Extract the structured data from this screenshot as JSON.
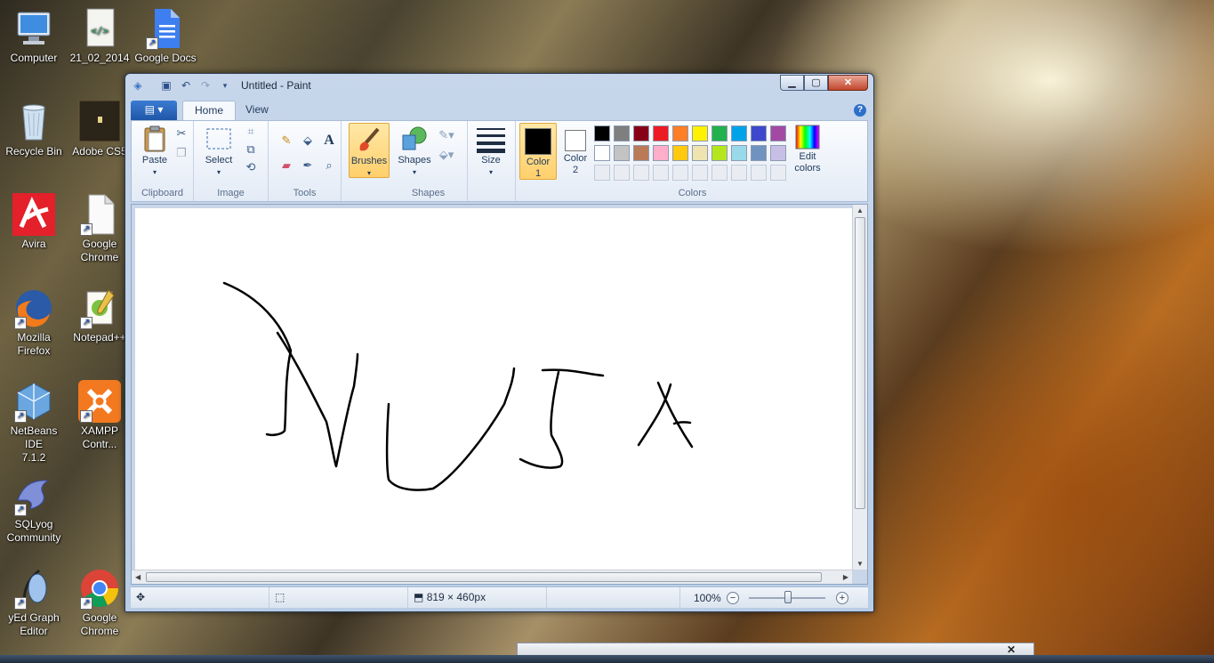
{
  "desktop": {
    "icons": [
      {
        "label": "Computer",
        "icon": "computer-icon"
      },
      {
        "label": "21_02_2014",
        "icon": "html-file-icon"
      },
      {
        "label": "Google Docs",
        "icon": "google-docs-icon"
      },
      {
        "label": "Recycle Bin",
        "icon": "recycle-bin-icon"
      },
      {
        "label": "Adobe CS5",
        "icon": "folder-icon"
      },
      {
        "label": "Avira",
        "icon": "avira-icon"
      },
      {
        "label": "Google\nChrome",
        "icon": "blank-file-icon"
      },
      {
        "label": "Mozilla\nFirefox",
        "icon": "firefox-icon"
      },
      {
        "label": "Notepad++",
        "icon": "notepad-plus-plus-icon"
      },
      {
        "label": "NetBeans IDE\n7.1.2",
        "icon": "netbeans-icon"
      },
      {
        "label": "XAMPP\nContr...",
        "icon": "xampp-icon"
      },
      {
        "label": "SQLyog\nCommunity",
        "icon": "sqlyog-icon"
      },
      {
        "label": "yEd Graph\nEditor",
        "icon": "yed-icon"
      },
      {
        "label": "Google\nChrome",
        "icon": "chrome-icon"
      }
    ]
  },
  "window": {
    "title": "Untitled - Paint",
    "caption": {
      "minimize": "▁",
      "maximize": "▢",
      "close": "✕"
    }
  },
  "ribbon": {
    "app_menu": "▤ ▾",
    "tabs": [
      {
        "label": "Home",
        "active": true
      },
      {
        "label": "View",
        "active": false
      }
    ],
    "groups": {
      "clipboard": {
        "label": "Clipboard",
        "paste": "Paste"
      },
      "image": {
        "label": "Image",
        "select": "Select"
      },
      "tools": {
        "label": "Tools"
      },
      "brushes": {
        "label": "Brushes"
      },
      "shapes": {
        "label": "Shapes",
        "shapes_btn": "Shapes"
      },
      "size": {
        "label": "Size"
      },
      "colors": {
        "label": "Colors",
        "color1": "Color\n1",
        "color2": "Color\n2",
        "edit_colors": "Edit\ncolors",
        "color1_value": "#000000",
        "color2_value": "#ffffff",
        "palette_row1": [
          "#000000",
          "#7f7f7f",
          "#880015",
          "#ed1c24",
          "#ff7f27",
          "#fff200",
          "#22b14c",
          "#00a2e8",
          "#3f48cc",
          "#a349a4"
        ],
        "palette_row2": [
          "#ffffff",
          "#c3c3c3",
          "#b97a57",
          "#ffaec9",
          "#ffc90e",
          "#efe4b0",
          "#b5e61d",
          "#99d9ea",
          "#7092be",
          "#c8bfe7"
        ]
      }
    }
  },
  "status": {
    "dimensions": "819 × 460px",
    "zoom": "100%",
    "zoom_level": 1.0
  },
  "canvas_drawing": "handwritten strokes spelling NUJA in black"
}
